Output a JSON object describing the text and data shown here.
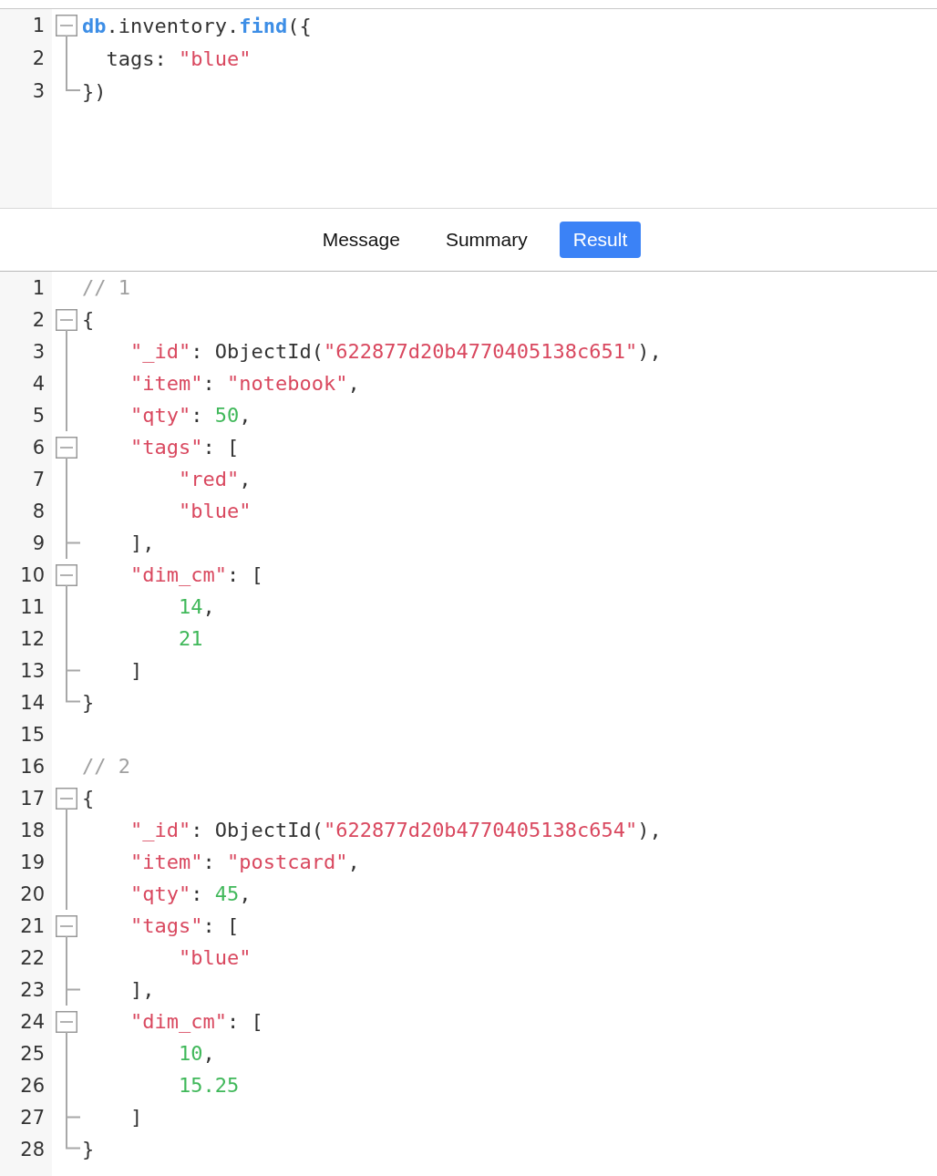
{
  "query_editor": {
    "lines": [
      {
        "number": "1",
        "kind": "start",
        "tokens": [
          {
            "kind": "ident",
            "text": "db"
          },
          {
            "kind": "plain",
            "text": ".inventory."
          },
          {
            "kind": "ident",
            "text": "find"
          },
          {
            "kind": "plain",
            "text": "({"
          }
        ]
      },
      {
        "number": "2",
        "kind": "guide",
        "tokens": [
          {
            "kind": "plain",
            "text": "  tags: "
          },
          {
            "kind": "string",
            "text": "\"blue\""
          }
        ]
      },
      {
        "number": "3",
        "kind": "last",
        "tokens": [
          {
            "kind": "plain",
            "text": "})"
          }
        ]
      }
    ]
  },
  "tabs": [
    {
      "label": "Message",
      "selected": false
    },
    {
      "label": "Summary",
      "selected": false
    },
    {
      "label": "Result",
      "selected": true
    }
  ],
  "result_editor": {
    "lines": [
      {
        "number": "1",
        "kind": "plain",
        "tokens": [
          {
            "kind": "comment",
            "text": "// 1"
          }
        ]
      },
      {
        "number": "2",
        "kind": "start",
        "tokens": [
          {
            "kind": "plain",
            "text": "{"
          }
        ]
      },
      {
        "number": "3",
        "kind": "guide",
        "tokens": [
          {
            "kind": "string",
            "text": "    \"_id\""
          },
          {
            "kind": "plain",
            "text": ": ObjectId("
          },
          {
            "kind": "string",
            "text": "\"622877d20b4770405138c651\""
          },
          {
            "kind": "plain",
            "text": "),"
          }
        ]
      },
      {
        "number": "4",
        "kind": "guide",
        "tokens": [
          {
            "kind": "string",
            "text": "    \"item\""
          },
          {
            "kind": "plain",
            "text": ": "
          },
          {
            "kind": "string",
            "text": "\"notebook\""
          },
          {
            "kind": "plain",
            "text": ","
          }
        ]
      },
      {
        "number": "5",
        "kind": "guide",
        "tokens": [
          {
            "kind": "string",
            "text": "    \"qty\""
          },
          {
            "kind": "plain",
            "text": ": "
          },
          {
            "kind": "number",
            "text": "50"
          },
          {
            "kind": "plain",
            "text": ","
          }
        ]
      },
      {
        "number": "6",
        "kind": "start",
        "tokens": [
          {
            "kind": "string",
            "text": "    \"tags\""
          },
          {
            "kind": "plain",
            "text": ": ["
          }
        ]
      },
      {
        "number": "7",
        "kind": "guide",
        "tokens": [
          {
            "kind": "string",
            "text": "        \"red\""
          },
          {
            "kind": "plain",
            "text": ","
          }
        ]
      },
      {
        "number": "8",
        "kind": "guide",
        "tokens": [
          {
            "kind": "string",
            "text": "        \"blue\""
          }
        ]
      },
      {
        "number": "9",
        "kind": "end",
        "tokens": [
          {
            "kind": "plain",
            "text": "    ],"
          }
        ]
      },
      {
        "number": "10",
        "kind": "start",
        "tokens": [
          {
            "kind": "string",
            "text": "    \"dim_cm\""
          },
          {
            "kind": "plain",
            "text": ": ["
          }
        ]
      },
      {
        "number": "11",
        "kind": "guide",
        "tokens": [
          {
            "kind": "number",
            "text": "        14"
          },
          {
            "kind": "plain",
            "text": ","
          }
        ]
      },
      {
        "number": "12",
        "kind": "guide",
        "tokens": [
          {
            "kind": "number",
            "text": "        21"
          }
        ]
      },
      {
        "number": "13",
        "kind": "end",
        "tokens": [
          {
            "kind": "plain",
            "text": "    ]"
          }
        ]
      },
      {
        "number": "14",
        "kind": "last",
        "tokens": [
          {
            "kind": "plain",
            "text": "}"
          }
        ]
      },
      {
        "number": "15",
        "kind": "plain"
      },
      {
        "number": "16",
        "kind": "plain",
        "tokens": [
          {
            "kind": "comment",
            "text": "// 2"
          }
        ]
      },
      {
        "number": "17",
        "kind": "start",
        "tokens": [
          {
            "kind": "plain",
            "text": "{"
          }
        ]
      },
      {
        "number": "18",
        "kind": "guide",
        "tokens": [
          {
            "kind": "string",
            "text": "    \"_id\""
          },
          {
            "kind": "plain",
            "text": ": ObjectId("
          },
          {
            "kind": "string",
            "text": "\"622877d20b4770405138c654\""
          },
          {
            "kind": "plain",
            "text": "),"
          }
        ]
      },
      {
        "number": "19",
        "kind": "guide",
        "tokens": [
          {
            "kind": "string",
            "text": "    \"item\""
          },
          {
            "kind": "plain",
            "text": ": "
          },
          {
            "kind": "string",
            "text": "\"postcard\""
          },
          {
            "kind": "plain",
            "text": ","
          }
        ]
      },
      {
        "number": "20",
        "kind": "guide",
        "tokens": [
          {
            "kind": "string",
            "text": "    \"qty\""
          },
          {
            "kind": "plain",
            "text": ": "
          },
          {
            "kind": "number",
            "text": "45"
          },
          {
            "kind": "plain",
            "text": ","
          }
        ]
      },
      {
        "number": "21",
        "kind": "start",
        "tokens": [
          {
            "kind": "string",
            "text": "    \"tags\""
          },
          {
            "kind": "plain",
            "text": ": ["
          }
        ]
      },
      {
        "number": "22",
        "kind": "guide",
        "tokens": [
          {
            "kind": "string",
            "text": "        \"blue\""
          }
        ]
      },
      {
        "number": "23",
        "kind": "end",
        "tokens": [
          {
            "kind": "plain",
            "text": "    ],"
          }
        ]
      },
      {
        "number": "24",
        "kind": "start",
        "tokens": [
          {
            "kind": "string",
            "text": "    \"dim_cm\""
          },
          {
            "kind": "plain",
            "text": ": ["
          }
        ]
      },
      {
        "number": "25",
        "kind": "guide",
        "tokens": [
          {
            "kind": "number",
            "text": "        10"
          },
          {
            "kind": "plain",
            "text": ","
          }
        ]
      },
      {
        "number": "26",
        "kind": "guide",
        "tokens": [
          {
            "kind": "number",
            "text": "        15.25"
          }
        ]
      },
      {
        "number": "27",
        "kind": "end",
        "tokens": [
          {
            "kind": "plain",
            "text": "    ]"
          }
        ]
      },
      {
        "number": "28",
        "kind": "last",
        "tokens": [
          {
            "kind": "plain",
            "text": "}"
          }
        ]
      }
    ]
  }
}
